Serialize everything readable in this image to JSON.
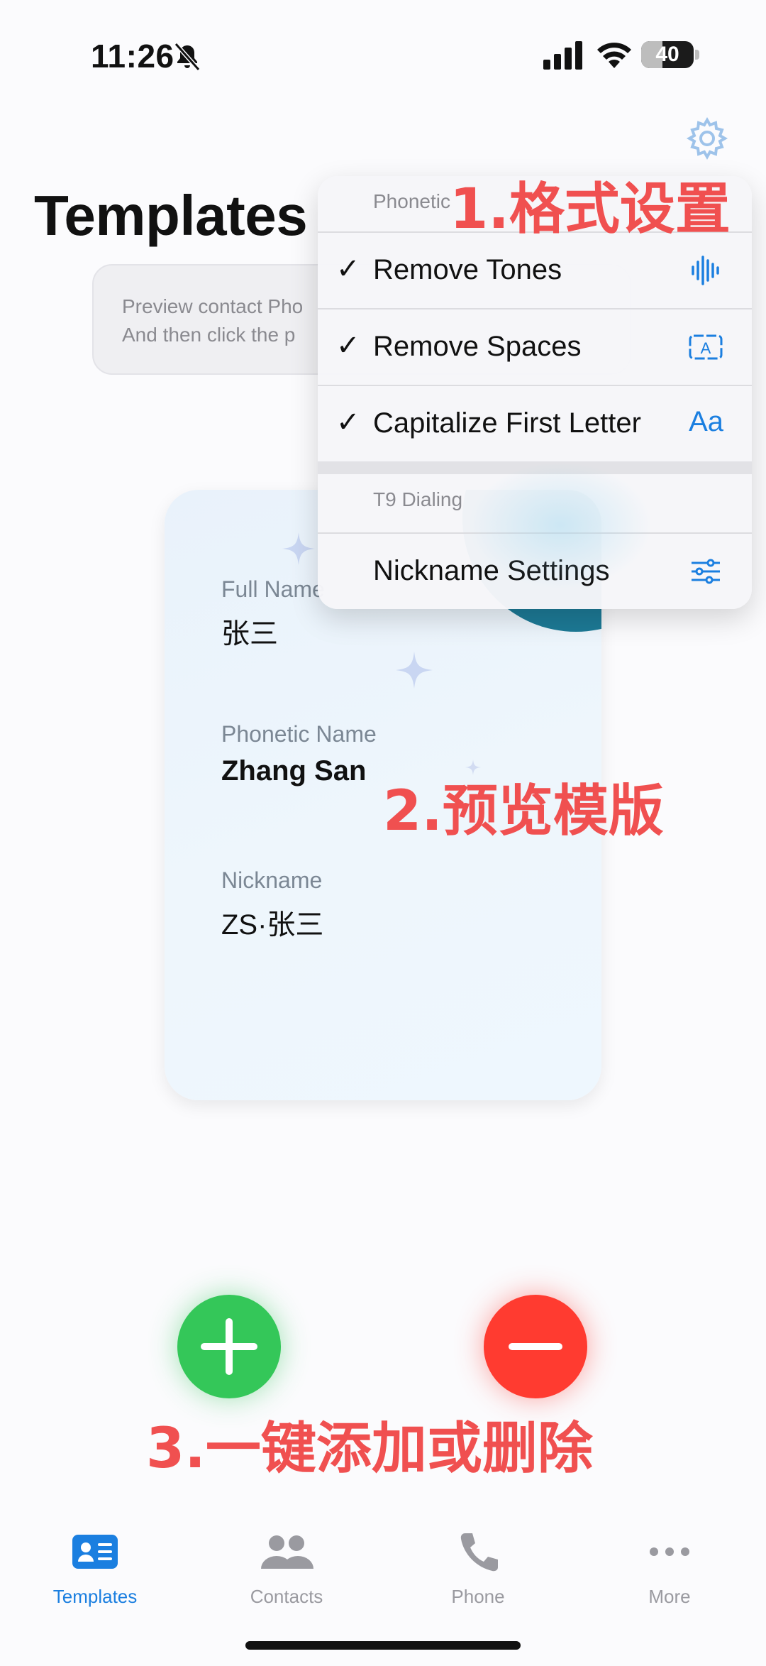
{
  "status_bar": {
    "time": "11:26",
    "battery": "40"
  },
  "colors": {
    "accent": "#1b7fe0",
    "add": "#34c759",
    "remove": "#ff3b30",
    "annotation": "#f05050",
    "teal": "#1d7a96"
  },
  "header": {
    "title": "Templates"
  },
  "hint": {
    "line1": "Preview contact Pho",
    "line2": "And then click the p"
  },
  "menu": {
    "section1": "Phonetic",
    "items": [
      {
        "label": "Remove Tones",
        "checked": "✓",
        "icon": "waveform-icon"
      },
      {
        "label": "Remove Spaces",
        "checked": "✓",
        "icon": "text-box-icon",
        "icon_text": "A"
      },
      {
        "label": "Capitalize First Letter",
        "checked": "✓",
        "icon_text": "Aa"
      }
    ],
    "section2": "T9 Dialing",
    "nickname": {
      "label": "Nickname Settings",
      "icon": "sliders-icon"
    }
  },
  "card": {
    "fields": [
      {
        "label": "Full Name",
        "value": "张三"
      },
      {
        "label": "Phonetic Name",
        "value": "Zhang San"
      },
      {
        "label": "Nickname",
        "value": "ZS·张三"
      }
    ]
  },
  "annotations": {
    "a1": "1.格式设置",
    "a2": "2.预览模版",
    "a3": "3.一键添加或删除"
  },
  "tabs": [
    {
      "label": "Templates",
      "icon": "contact-card-icon",
      "active": true
    },
    {
      "label": "Contacts",
      "icon": "people-icon",
      "active": false
    },
    {
      "label": "Phone",
      "icon": "phone-icon",
      "active": false
    },
    {
      "label": "More",
      "icon": "ellipsis-icon",
      "active": false
    }
  ]
}
